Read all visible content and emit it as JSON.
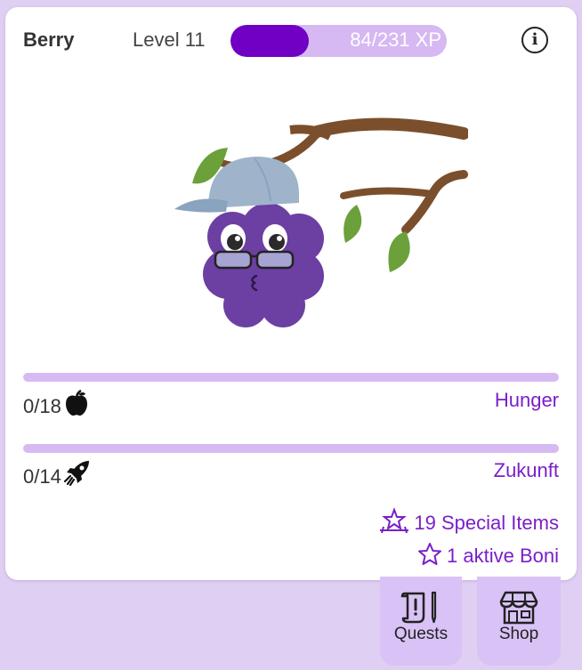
{
  "pet": {
    "name": "Berry",
    "level_label": "Level 11",
    "xp_text": "84/231 XP",
    "xp_fraction": 0.364
  },
  "stats": [
    {
      "count": "0/18",
      "name": "Hunger",
      "icon": "apple-icon",
      "fill_fraction": 0
    },
    {
      "count": "0/14",
      "name": "Zukunft",
      "icon": "rocket-icon",
      "fill_fraction": 0
    }
  ],
  "links": {
    "special_items": "19 Special Items",
    "boni": "1 aktive Boni"
  },
  "nav": {
    "quests": "Quests",
    "shop": "Shop"
  },
  "colors": {
    "accent": "#7a1fc9",
    "xp_fill": "#7000c4",
    "bar_track": "#d8baf3",
    "background": "#dfcff2"
  }
}
